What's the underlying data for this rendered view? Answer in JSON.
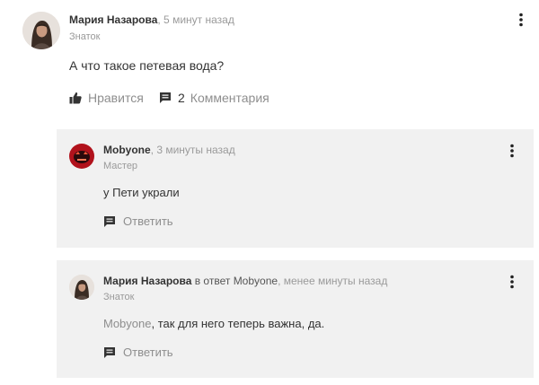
{
  "post": {
    "author": "Мария Назарова",
    "time": ", 5 минут назад",
    "role": "Знаток",
    "text": "А что такое петевая вода?",
    "like_label": "Нравится",
    "comments_count": "2",
    "comments_label": "Комментария"
  },
  "replies": [
    {
      "author": "Mobyone",
      "time": ", 3 минуты назад",
      "role": "Мастер",
      "text": "у Пети украли",
      "reply_label": "Ответить"
    },
    {
      "author": "Мария Назарова",
      "in_reply_prefix": " в ответ ",
      "in_reply_to": "Mobyone",
      "time": ", менее минуты назад",
      "role": "Знаток",
      "mention": "Mobyone",
      "text": ", так для него теперь важна, да.",
      "reply_label": "Ответить"
    }
  ],
  "icons": {
    "like": "thumbs-up-icon",
    "comment": "comment-icon",
    "menu": "kebab-menu-icon"
  },
  "colors": {
    "reply_background": "#f1f1f1",
    "muted_text": "#9a9a9a",
    "body_text": "#333333",
    "mobyone_avatar": "#b1121c"
  }
}
